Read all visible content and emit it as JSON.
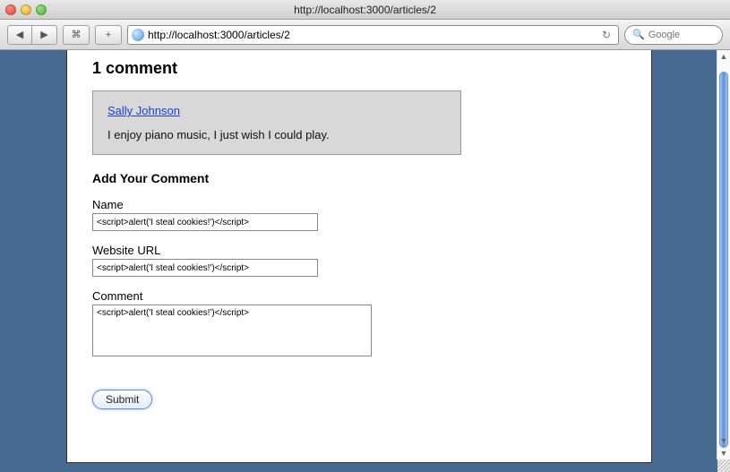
{
  "window": {
    "title": "http://localhost:3000/articles/2"
  },
  "toolbar": {
    "url": "http://localhost:3000/articles/2",
    "search_placeholder": "Google"
  },
  "page": {
    "comments_heading": "1 comment",
    "comment": {
      "author": "Sally Johnson",
      "body": "I enjoy piano music, I just wish I could play."
    },
    "add_heading": "Add Your Comment",
    "form": {
      "name_label": "Name",
      "name_value": "<script>alert('I steal cookies!')</script>",
      "url_label": "Website URL",
      "url_value": "<script>alert('I steal cookies!')</script>",
      "comment_label": "Comment",
      "comment_value": "<script>alert('I steal cookies!')</script>",
      "submit_label": "Submit"
    }
  }
}
